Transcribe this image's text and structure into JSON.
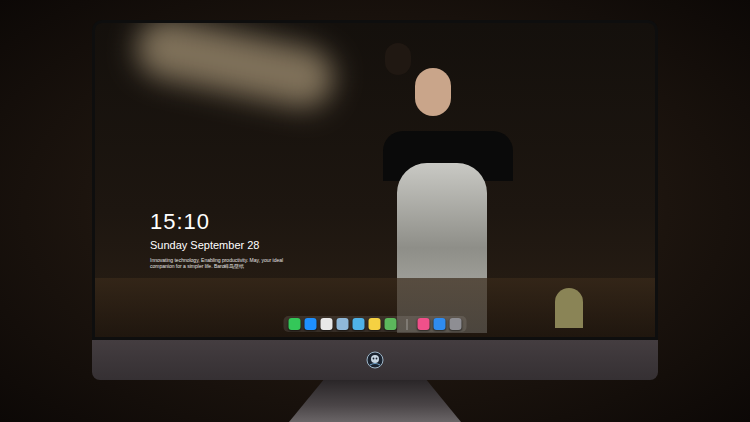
{
  "lock_screen": {
    "time": "15:10",
    "date": "Sunday September 28",
    "caption": "Innovating technology, Enabling productivity. May, your ideal companion for a simpler life. Baro蜂鸟壁纸"
  },
  "dock": {
    "apps": [
      {
        "color": "#34c759"
      },
      {
        "color": "#1e90ff"
      },
      {
        "color": "#e8e8e8"
      },
      {
        "color": "#8fb8d8"
      },
      {
        "color": "#4fb3e8"
      },
      {
        "color": "#f5d142"
      },
      {
        "color": "#5cb85c"
      }
    ],
    "recent": [
      {
        "color": "#f0508a"
      },
      {
        "color": "#2f8cf0"
      },
      {
        "color": "#8e8e93"
      }
    ]
  }
}
